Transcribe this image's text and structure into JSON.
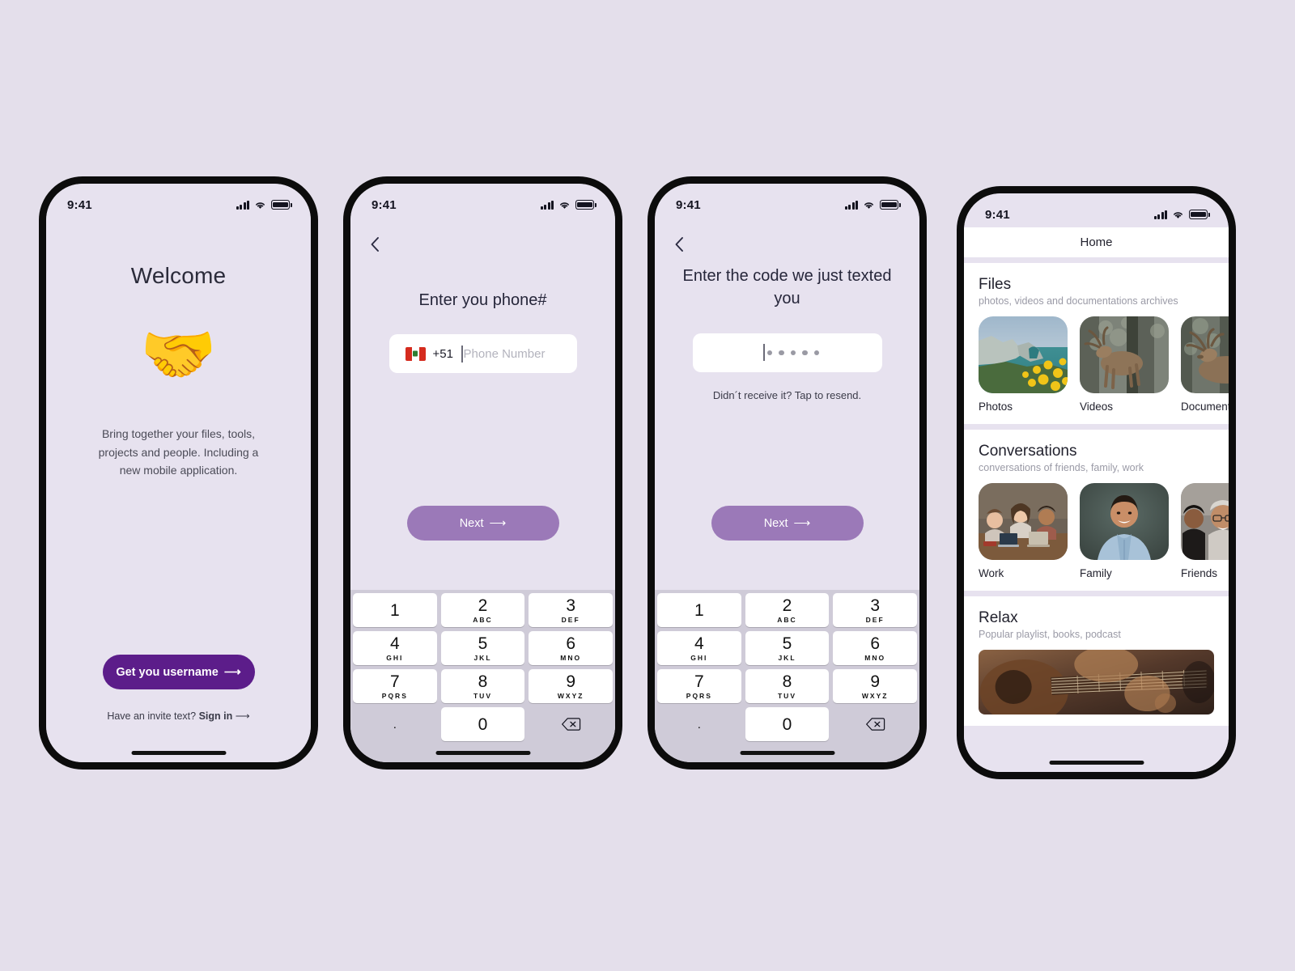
{
  "canvas": {
    "background": "#e4dfeb"
  },
  "theme": {
    "primary_dark": "#5c1d8a",
    "primary_light": "#9b79b8",
    "screen_bg": "#e7e2ef",
    "keypad_bg": "#cfcbd8"
  },
  "status_bar": {
    "time": "9:41"
  },
  "screens": [
    {
      "name": "welcome",
      "title": "Welcome",
      "emoji": "🤝",
      "emoji_name": "handshake-emoji",
      "description": "Bring together your files, tools, projects and people. Including a new mobile application.",
      "cta_label": "Get you username",
      "cta_arrow": "⟶",
      "signin_prefix": "Have an invite text? ",
      "signin_link": "Sign in",
      "signin_arrow": "⟶"
    },
    {
      "name": "phone-entry",
      "heading": "Enter you phone#",
      "country_flag": "peru-flag",
      "dial_code": "+51",
      "phone_placeholder": "Phone Number",
      "phone_value": "",
      "next_label": "Next",
      "next_arrow": "⟶"
    },
    {
      "name": "verification-code",
      "heading": "Enter the code we just texted you",
      "code_masked_digits": 5,
      "resend_text": "Didn´t receive it? Tap to resend.",
      "next_label": "Next",
      "next_arrow": "⟶"
    },
    {
      "name": "home",
      "nav_title": "Home",
      "sections": [
        {
          "title": "Files",
          "subtitle": "photos, videos and documentations archives",
          "tiles": [
            {
              "caption": "Photos",
              "image": "cliff-coast-yellow-flowers"
            },
            {
              "caption": "Videos",
              "image": "deer-standing-forest"
            },
            {
              "caption": "Documents",
              "image": "deer-resting-forest"
            }
          ]
        },
        {
          "title": "Conversations",
          "subtitle": "conversations of friends, family, work",
          "tiles": [
            {
              "caption": "Work",
              "image": "colleagues-at-table-laptops"
            },
            {
              "caption": "Family",
              "image": "smiling-man-blue-shirt"
            },
            {
              "caption": "Friends",
              "image": "group-of-friends-jackets"
            }
          ]
        },
        {
          "title": "Relax",
          "subtitle": "Popular playlist, books, podcast",
          "banner": {
            "image": "hands-playing-acoustic-guitar"
          }
        }
      ]
    }
  ],
  "keypad": {
    "keys": [
      {
        "num": "1",
        "letters": ""
      },
      {
        "num": "2",
        "letters": "ABC"
      },
      {
        "num": "3",
        "letters": "DEF"
      },
      {
        "num": "4",
        "letters": "GHI"
      },
      {
        "num": "5",
        "letters": "JKL"
      },
      {
        "num": "6",
        "letters": "MNO"
      },
      {
        "num": "7",
        "letters": "PQRS"
      },
      {
        "num": "8",
        "letters": "TUV"
      },
      {
        "num": "9",
        "letters": "WXYZ"
      }
    ],
    "dot_key": ".",
    "zero_key": "0",
    "delete_key": "delete-backspace"
  }
}
